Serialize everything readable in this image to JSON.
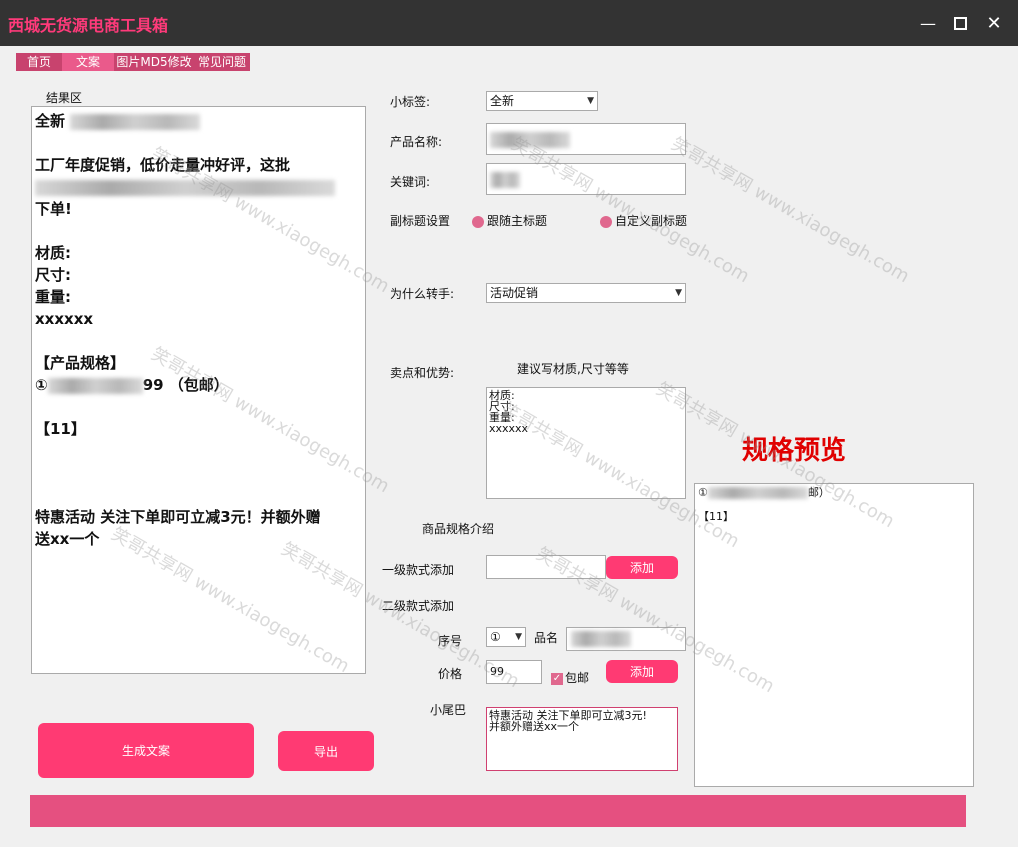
{
  "window": {
    "title": "西城无货源电商工具箱"
  },
  "tabs": [
    {
      "label": "首页",
      "color": "#c8436e"
    },
    {
      "label": "文案",
      "color": "#ea5a8b"
    },
    {
      "label": "图片MD5修改",
      "color": "#c8436e"
    },
    {
      "label": "常见问题",
      "color": "#c8436e"
    }
  ],
  "result": {
    "label": "结果区",
    "lines": [
      "全新",
      "",
      "工厂年度促销，低价走量冲好评，这批",
      "",
      "下单!",
      "",
      "材质:",
      "尺寸:",
      "重量:",
      "xxxxxx",
      "",
      "【产品规格】",
      "①",
      "99 （包邮）",
      "",
      "【11】",
      "",
      "特惠活动 关注下单即可立减3元！并额外赠",
      "送xx一个"
    ]
  },
  "form": {
    "small_tag_label": "小标签:",
    "small_tag_value": "全新",
    "product_name_label": "产品名称:",
    "keyword_label": "关键词:",
    "subtitle_label": "副标题设置",
    "subtitle_opt1": "跟随主标题",
    "subtitle_opt2": "自定义副标题",
    "reason_label": "为什么转手:",
    "reason_value": "活动促销",
    "selling_label": "卖点和优势:",
    "selling_hint": "建议写材质,尺寸等等",
    "selling_text": "材质:\n尺寸:\n重量:\nxxxxxx",
    "spec_intro_label": "商品规格介绍",
    "level1_label": "一级款式添加",
    "add_label": "添加",
    "level2_label": "二级款式添加",
    "seq_label": "序号",
    "seq_value": "①",
    "name_label": "品名",
    "price_label": "价格",
    "price_value": "99",
    "free_ship_label": "包邮",
    "tail_label": "小尾巴",
    "tail_text": "特惠活动 关注下单即可立减3元!\n并额外赠送xx一个"
  },
  "preview": {
    "title": "规格预览",
    "line1_prefix": "①",
    "line1_suffix": "邮）",
    "line2": "【11】"
  },
  "actions": {
    "generate_label": "生成文案",
    "export_label": "导出"
  },
  "watermark": {
    "text": "笑哥共享网 www.xiaogegh.com"
  },
  "colors": {
    "accent": "#ff3a73",
    "title": "#ff3a7a",
    "preview_title": "#e00000",
    "bar": "#e55080"
  }
}
